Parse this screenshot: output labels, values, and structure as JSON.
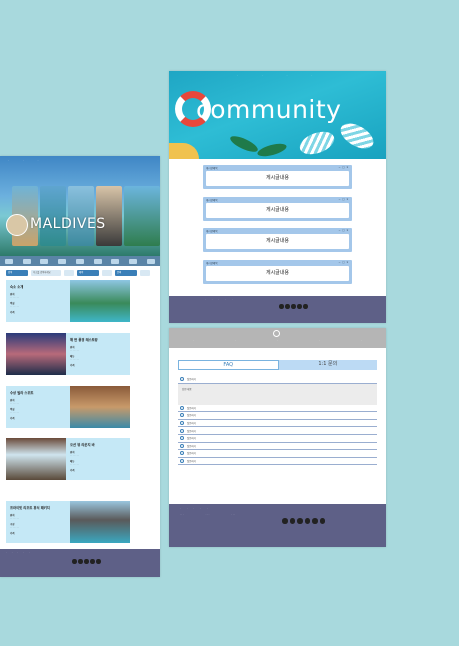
{
  "left_page": {
    "hero_title": "MALDIVES",
    "search": {
      "placeholder": "숙소를 검색하세요",
      "buttons": [
        "검색",
        "예약",
        "문의"
      ]
    },
    "cards": [
      {
        "title": "숙소 소개",
        "sub1": "위치",
        "sub2": "객실",
        "sub3": "가격"
      },
      {
        "title": "해 변 풍경 레스토랑",
        "sub1": "위치",
        "sub2": "메뉴",
        "sub3": "가격"
      },
      {
        "title": "수상 빌라 스위트",
        "sub1": "위치",
        "sub2": "객실",
        "sub3": "가격"
      },
      {
        "title": "오션 뷰 라운지 바",
        "sub1": "위치",
        "sub2": "메뉴",
        "sub3": "가격"
      },
      {
        "title": "프라이빗 리조트 휴식 패키지",
        "sub1": "위치",
        "sub2": "구성",
        "sub3": "가격"
      }
    ]
  },
  "community_page": {
    "hero_title": "community",
    "posts": [
      {
        "title": "게시글제목",
        "body": "게시글내용"
      },
      {
        "title": "게시글제목",
        "body": "게시글내용"
      },
      {
        "title": "게시글제목",
        "body": "게시글내용"
      },
      {
        "title": "게시글제목",
        "body": "게시글내용"
      }
    ]
  },
  "faq_page": {
    "tabs": [
      "FAQ",
      "1:1 문의"
    ],
    "answer": "답변 내용",
    "questions": [
      "질문하기",
      "질문하기",
      "질문하기",
      "질문하기",
      "질문하기",
      "질문하기",
      "질문하기",
      "질문하기",
      "질문하기"
    ]
  }
}
